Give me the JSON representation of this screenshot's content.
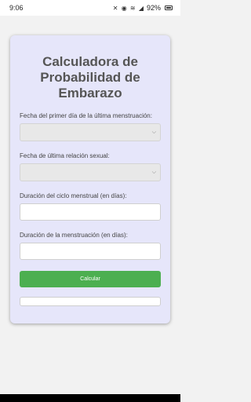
{
  "status_bar": {
    "time": "9:06",
    "icons": "✕ ◉ ≋ ◢",
    "battery": "92%"
  },
  "app": {
    "title": "Calculadora de Probabilidad de Embarazo"
  },
  "form": {
    "last_period_label": "Fecha del primer día de la última menstruación:",
    "last_period_value": "",
    "last_intercourse_label": "Fecha de última relación sexual:",
    "last_intercourse_value": "",
    "cycle_length_label": "Duración del ciclo menstrual (en días):",
    "cycle_length_value": "",
    "period_length_label": "Duración de la menstruación (en días):",
    "period_length_value": "",
    "calculate_label": "Calcular",
    "result_text": ""
  },
  "colors": {
    "card_background": "#e6e6fa",
    "button": "#4caf50"
  }
}
